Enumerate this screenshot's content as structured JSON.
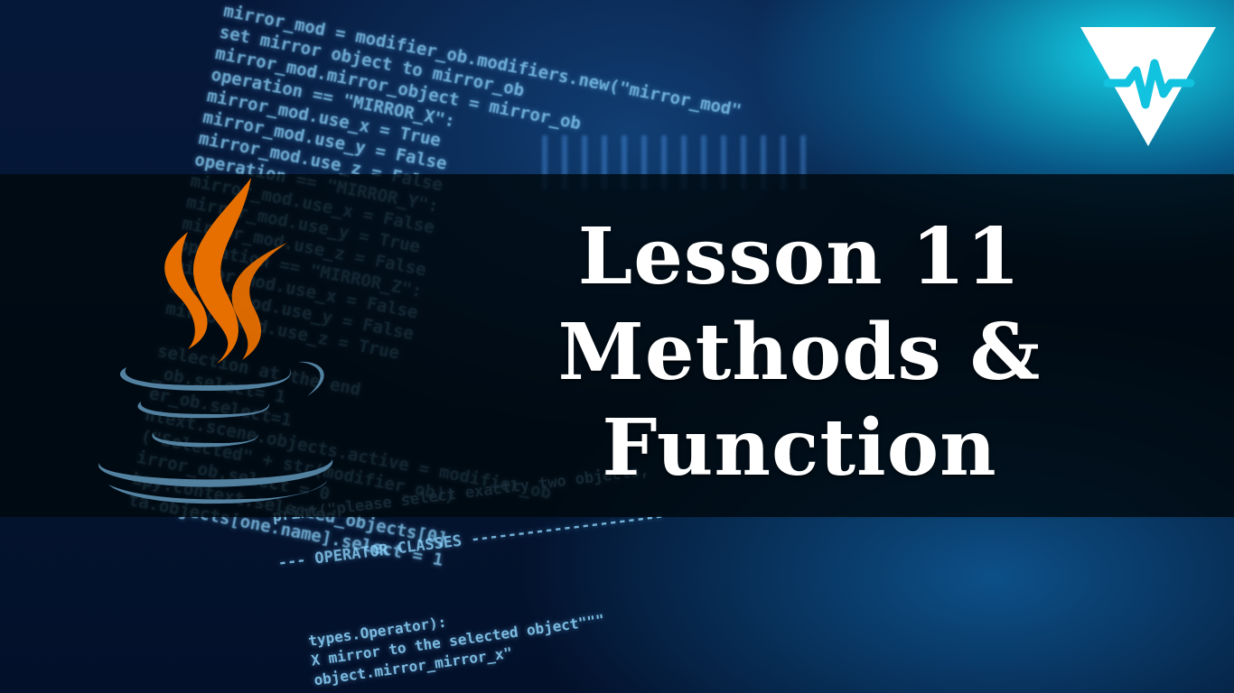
{
  "thumbnail": {
    "title_lines": [
      "Lesson 11",
      "Methods &",
      "Function"
    ]
  },
  "background_code": {
    "top_lines": [
      "mirror_mod = modifier_ob.modifiers.new(\"mirror_mod\"",
      "set mirror object to mirror_ob",
      "mirror_mod.mirror_object = mirror_ob",
      "operation == \"MIRROR_X\":",
      "mirror_mod.use_x = True",
      "mirror_mod.use_y = False",
      "mirror_mod.use_z = False",
      "operation == \"MIRROR_Y\":",
      "mirror_mod.use_x = False",
      "mirror_mod.use_y = True",
      "mirror_mod.use_z = False",
      "operation == \"MIRROR_Z\":",
      "mirror_mod.use_x = False",
      "mirror_mod.use_y = False",
      "mirror_mod.use_z = True",
      "",
      "selection at the end",
      "_ob.select= 1",
      "er_ob.select=1",
      "ntext.scene.objects.active = modifier_ob",
      "(\"Selected\" + str(modifier_ob))",
      "irror_ob.select = 0",
      "bpy.context.selected_objects[0]",
      "ta.objects[one.name].select = 1"
    ],
    "middle_lines": [
      "print(\"please select exactly two objects,",
      "",
      "--- OPERATOR CLASSES ---------------------"
    ],
    "bottom_lines": [
      "types.Operator):",
      "X mirror to the selected object\"\"\"",
      "object.mirror_mirror_x\""
    ]
  },
  "colors": {
    "java_flame": "#e76f00",
    "java_cup": "#5382a1",
    "brand_logo": "#ffffff",
    "title_text": "#ffffff"
  },
  "icons": {
    "brand": "brand-logo-icon",
    "java": "java-cup-icon"
  }
}
